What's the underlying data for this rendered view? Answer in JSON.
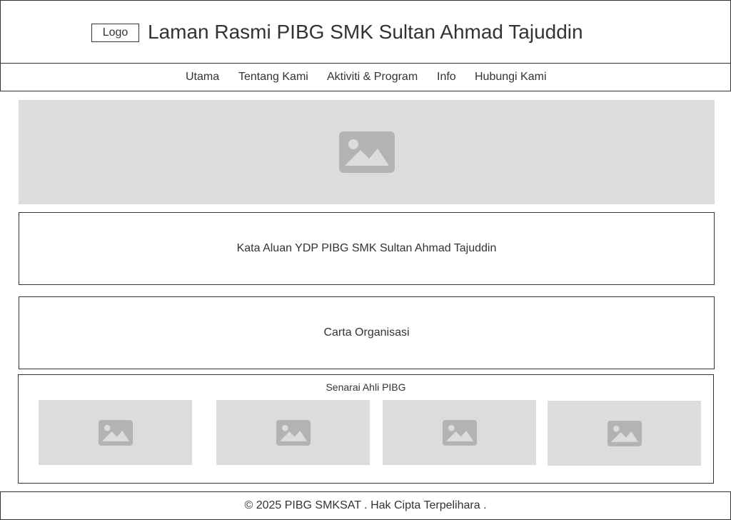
{
  "header": {
    "logo_label": "Logo",
    "title": "Laman Rasmi PIBG SMK Sultan Ahmad Tajuddin"
  },
  "nav": {
    "items": [
      {
        "label": "Utama"
      },
      {
        "label": "Tentang Kami"
      },
      {
        "label": "Aktiviti & Program"
      },
      {
        "label": "Info"
      },
      {
        "label": "Hubungi Kami"
      }
    ]
  },
  "hero": {
    "icon": "image-icon"
  },
  "sections": {
    "message": "Kata Aluan YDP PIBG SMK Sultan Ahmad Tajuddin",
    "org_chart": "Carta Organisasi"
  },
  "members": {
    "title": "Senarai Ahli PIBG",
    "icon": "image-icon"
  },
  "footer": {
    "text": "© 2025 PIBG SMKSAT . Hak Cipta Terpelihara ."
  },
  "colors": {
    "border": "#333333",
    "placeholder_bg": "#dcdcdc",
    "placeholder_icon": "#b3b3b3"
  }
}
